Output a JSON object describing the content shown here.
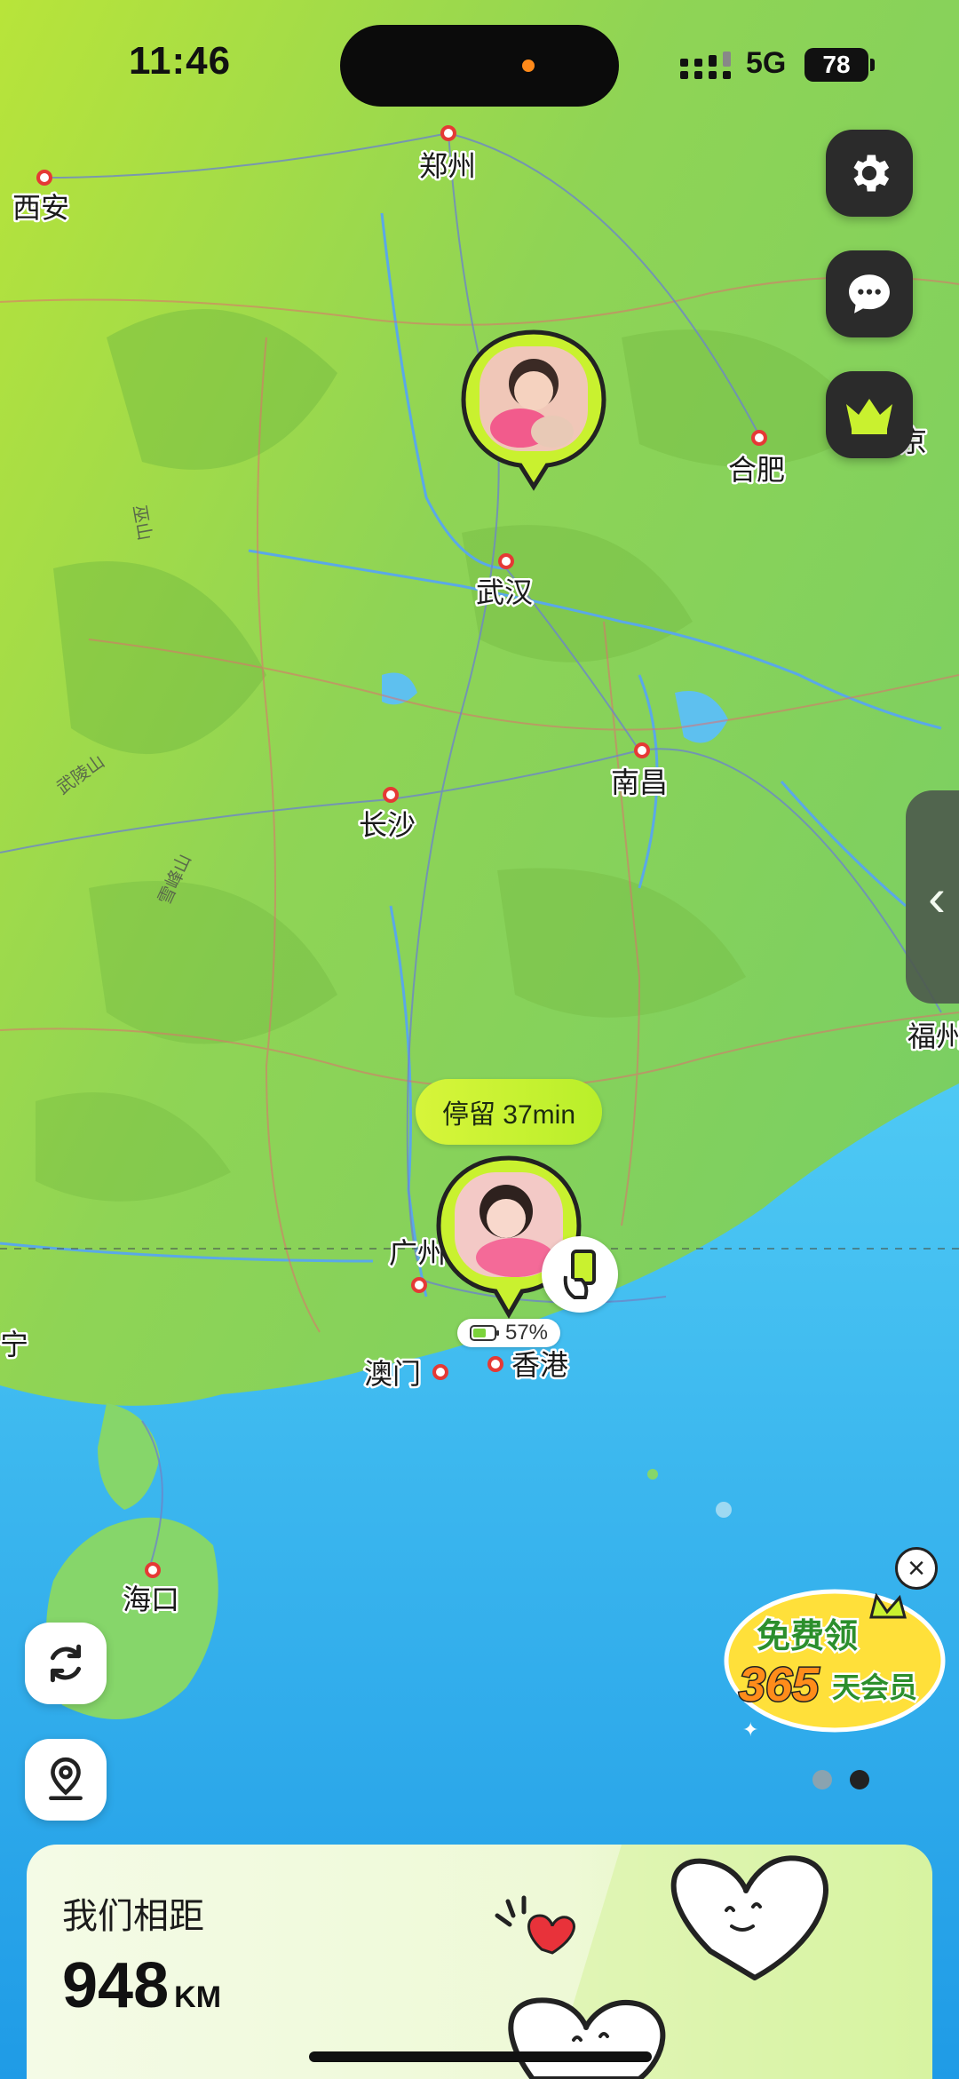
{
  "status_bar": {
    "time": "11:46",
    "network": "5G",
    "battery": "78"
  },
  "map": {
    "cities": [
      "郑州",
      "西安",
      "合肥",
      "武汉",
      "南昌",
      "长沙",
      "福州",
      "广州",
      "澳门",
      "香港",
      "海口",
      "京",
      "宁"
    ],
    "mountains": [
      "武陵山",
      "雪峰山",
      "巫山"
    ]
  },
  "pins": {
    "partner_a": {
      "stay_label": "停留 37min",
      "battery": "57%"
    }
  },
  "toolbar": {
    "settings_icon": "gear-icon",
    "chat_icon": "chat-icon",
    "vip_icon": "crown-icon"
  },
  "promo": {
    "line1": "免费领",
    "line2": "365",
    "line3": "天会员"
  },
  "distance_card": {
    "label": "我们相距",
    "value": "948",
    "unit": "KM"
  },
  "colors": {
    "land": "#7fd35a",
    "sea": "#2aa7ee",
    "accent": "#c9f12f"
  }
}
